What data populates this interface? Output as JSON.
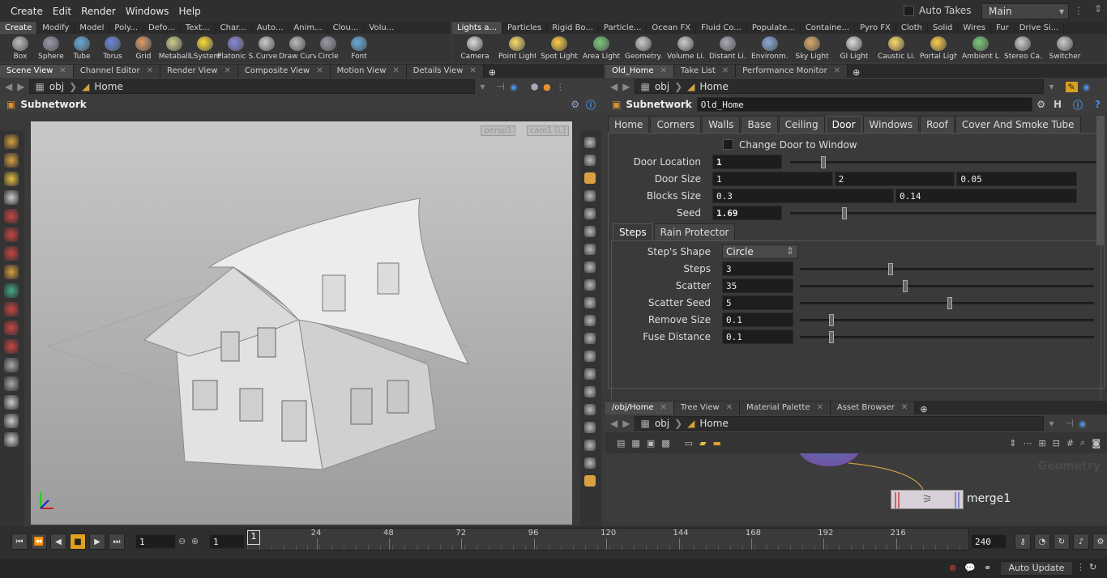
{
  "menu": [
    "Create",
    "Edit",
    "Render",
    "Windows",
    "Help"
  ],
  "auto_takes": "Auto Takes",
  "desktop": "Main",
  "shelf_left": {
    "tabs": [
      "Create",
      "Modify",
      "Model",
      "Poly...",
      "Defo...",
      "Text...",
      "Char...",
      "Auto...",
      "Anim...",
      "Clou...",
      "Volu..."
    ],
    "tools": [
      "Box",
      "Sphere",
      "Tube",
      "Torus",
      "Grid",
      "Metaball",
      "LSystem",
      "Platonic S...",
      "Curve",
      "Draw Curve",
      "Circle",
      "Font"
    ]
  },
  "shelf_right": {
    "tabs": [
      "Lights a...",
      "Particles",
      "Rigid Bo...",
      "Particle...",
      "Ocean FX",
      "Fluid Co...",
      "Populate...",
      "Containe...",
      "Pyro FX",
      "Cloth",
      "Solid",
      "Wires",
      "Fur",
      "Drive Si..."
    ],
    "tools": [
      "Camera",
      "Point Light",
      "Spot Light",
      "Area Light",
      "Geometry...",
      "Volume Li...",
      "Distant Li...",
      "Environm...",
      "Sky Light",
      "GI Light",
      "Caustic Li...",
      "Portal Light",
      "Ambient L...",
      "Stereo Ca...",
      "Switcher"
    ]
  },
  "left_pane": {
    "tabs": [
      "Scene View",
      "Channel Editor",
      "Render View",
      "Composite View",
      "Motion View",
      "Details View"
    ],
    "path": [
      "obj",
      "Home"
    ],
    "header": "Subnetwork",
    "persp": "persp1",
    "cam": "cam1 [L]"
  },
  "right_pane": {
    "tabs": [
      "Old_Home",
      "Take List",
      "Performance Monitor"
    ],
    "path": [
      "obj",
      "Home"
    ],
    "node_type": "Subnetwork",
    "node_name": "Old_Home",
    "folder_tabs": [
      "Home",
      "Corners",
      "Walls",
      "Base",
      "Ceiling",
      "Door",
      "Windows",
      "Roof",
      "Cover And Smoke Tube"
    ],
    "toggle_label": "Change Door to Window",
    "params": [
      {
        "label": "Door Location",
        "values": [
          "1"
        ],
        "slider": 0.1
      },
      {
        "label": "Door Size",
        "values": [
          "1",
          "2",
          "0.05"
        ]
      },
      {
        "label": "Blocks Size",
        "values": [
          "0.3",
          "0.14"
        ]
      },
      {
        "label": "Seed",
        "values": [
          "1.69"
        ],
        "slider": 0.17
      }
    ],
    "sub_tabs": [
      "Steps",
      "Rain Protector"
    ],
    "shape_label": "Step's Shape",
    "shape_value": "Circle",
    "sub_params": [
      {
        "label": "Steps",
        "value": "3",
        "slider": 0.3
      },
      {
        "label": "Scatter",
        "value": "35",
        "slider": 0.35
      },
      {
        "label": "Scatter Seed",
        "value": "5",
        "slider": 0.5
      },
      {
        "label": "Remove Size",
        "value": "0.1",
        "slider": 0.1
      },
      {
        "label": "Fuse Distance",
        "value": "0.1",
        "slider": 0.1
      }
    ]
  },
  "network_pane": {
    "tabs": [
      "/obj/Home",
      "Tree View",
      "Material Palette",
      "Asset Browser"
    ],
    "path": [
      "obj",
      "Home"
    ],
    "context_label": "Geometry",
    "node_label": "merge1"
  },
  "timeline": {
    "start_frame": "1",
    "current_frame": "1",
    "range_start": "1",
    "ticks": [
      "24",
      "48",
      "72",
      "96",
      "120",
      "144",
      "168",
      "192",
      "216"
    ],
    "end_frame": "240"
  },
  "status": {
    "auto_update": "Auto Update"
  },
  "colors": {
    "accent": "#e0a020",
    "field_bg": "#1d1d1d",
    "viewport": "#b4b4b4"
  }
}
